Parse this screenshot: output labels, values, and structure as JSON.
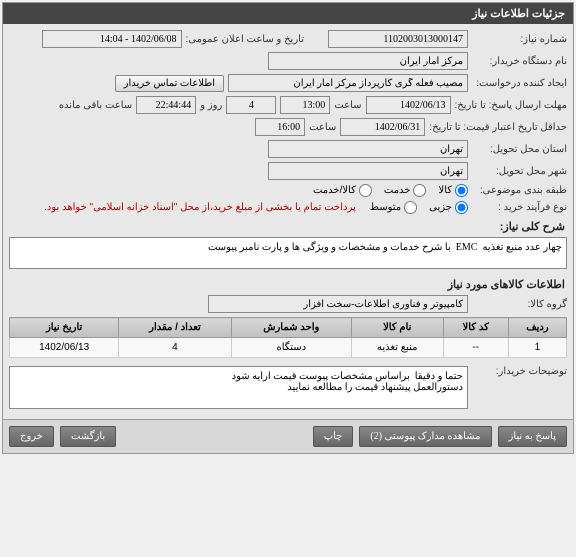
{
  "panel_title": "جزئیات اطلاعات نیاز",
  "fields": {
    "need_no_label": "شماره نیاز:",
    "need_no": "1102003013000147",
    "public_date_label": "تاریخ و ساعت اعلان عمومی:",
    "public_date": "1402/06/08 - 14:04",
    "buyer_label": "نام دستگاه خریدار:",
    "buyer": "مرکز آمار ایران",
    "creator_label": "ایجاد کننده درخواست:",
    "creator": "مصیب فعله گری کارپرداز مرکز آمار ایران",
    "contact_btn": "اطلاعات تماس خریدار",
    "deadline_label": "مهلت ارسال پاسخ: تا تاریخ:",
    "deadline_date": "1402/06/13",
    "time_label": "ساعت",
    "deadline_time": "13:00",
    "day_label": "روز و",
    "days_remain": "4",
    "hours_remain": "22:44:44",
    "hours_label": "ساعت باقی مانده",
    "validity_label": "حداقل تاریخ اعتبار قیمت: تا تاریخ:",
    "validity_date": "1402/06/31",
    "validity_time": "16:00",
    "city_demand_label": "استان محل تحویل:",
    "city_demand": "تهران",
    "city_deliver_label": "شهر محل تحویل:",
    "city_deliver": "تهران",
    "category_label": "طبقه بندی موضوعی:",
    "cat_goods": "کالا",
    "cat_service": "خدمت",
    "cat_goods_service": "کالا/خدمت",
    "process_label": "نوع فرآیند خرید :",
    "proc_partial": "جزیی",
    "proc_medium": "متوسط",
    "process_note": "پرداخت تمام یا بخشی از مبلغ خرید،از محل \"اسناد خزانه اسلامی\" خواهد بود.",
    "summary_label": "شرح کلی نیاز:",
    "summary_text": "چهار عدد منبع تغذیه  EMC  با شرح خدمات و مشخصات و ویژگی ها و پارت نامبر پیوست",
    "items_section": "اطلاعات کالاهای مورد نیاز",
    "group_label": "گروه کالا:",
    "group_value": "کامپیوتر و فناوری اطلاعات-سخت افزار",
    "buyer_desc_label": "توضیحات خریدار:",
    "buyer_desc_text": "حتما و دقیقا  براساس مشخصات پیوست قیمت ارایه شود\nدستورالعمل پیشنهاد قیمت را مطالعه نمایید"
  },
  "table": {
    "headers": {
      "row": "ردیف",
      "code": "کد کالا",
      "name": "نام کالا",
      "unit": "واحد شمارش",
      "qty": "تعداد / مقدار",
      "date": "تاریخ نیاز"
    },
    "rows": [
      {
        "row": "1",
        "code": "--",
        "name": "منبع تغذیه",
        "unit": "دستگاه",
        "qty": "4",
        "date": "1402/06/13"
      }
    ]
  },
  "footer": {
    "respond": "پاسخ به نیاز",
    "attachments": "مشاهده مدارک پیوستی (2)",
    "print": "چاپ",
    "back": "بازگشت",
    "exit": "خروج"
  }
}
